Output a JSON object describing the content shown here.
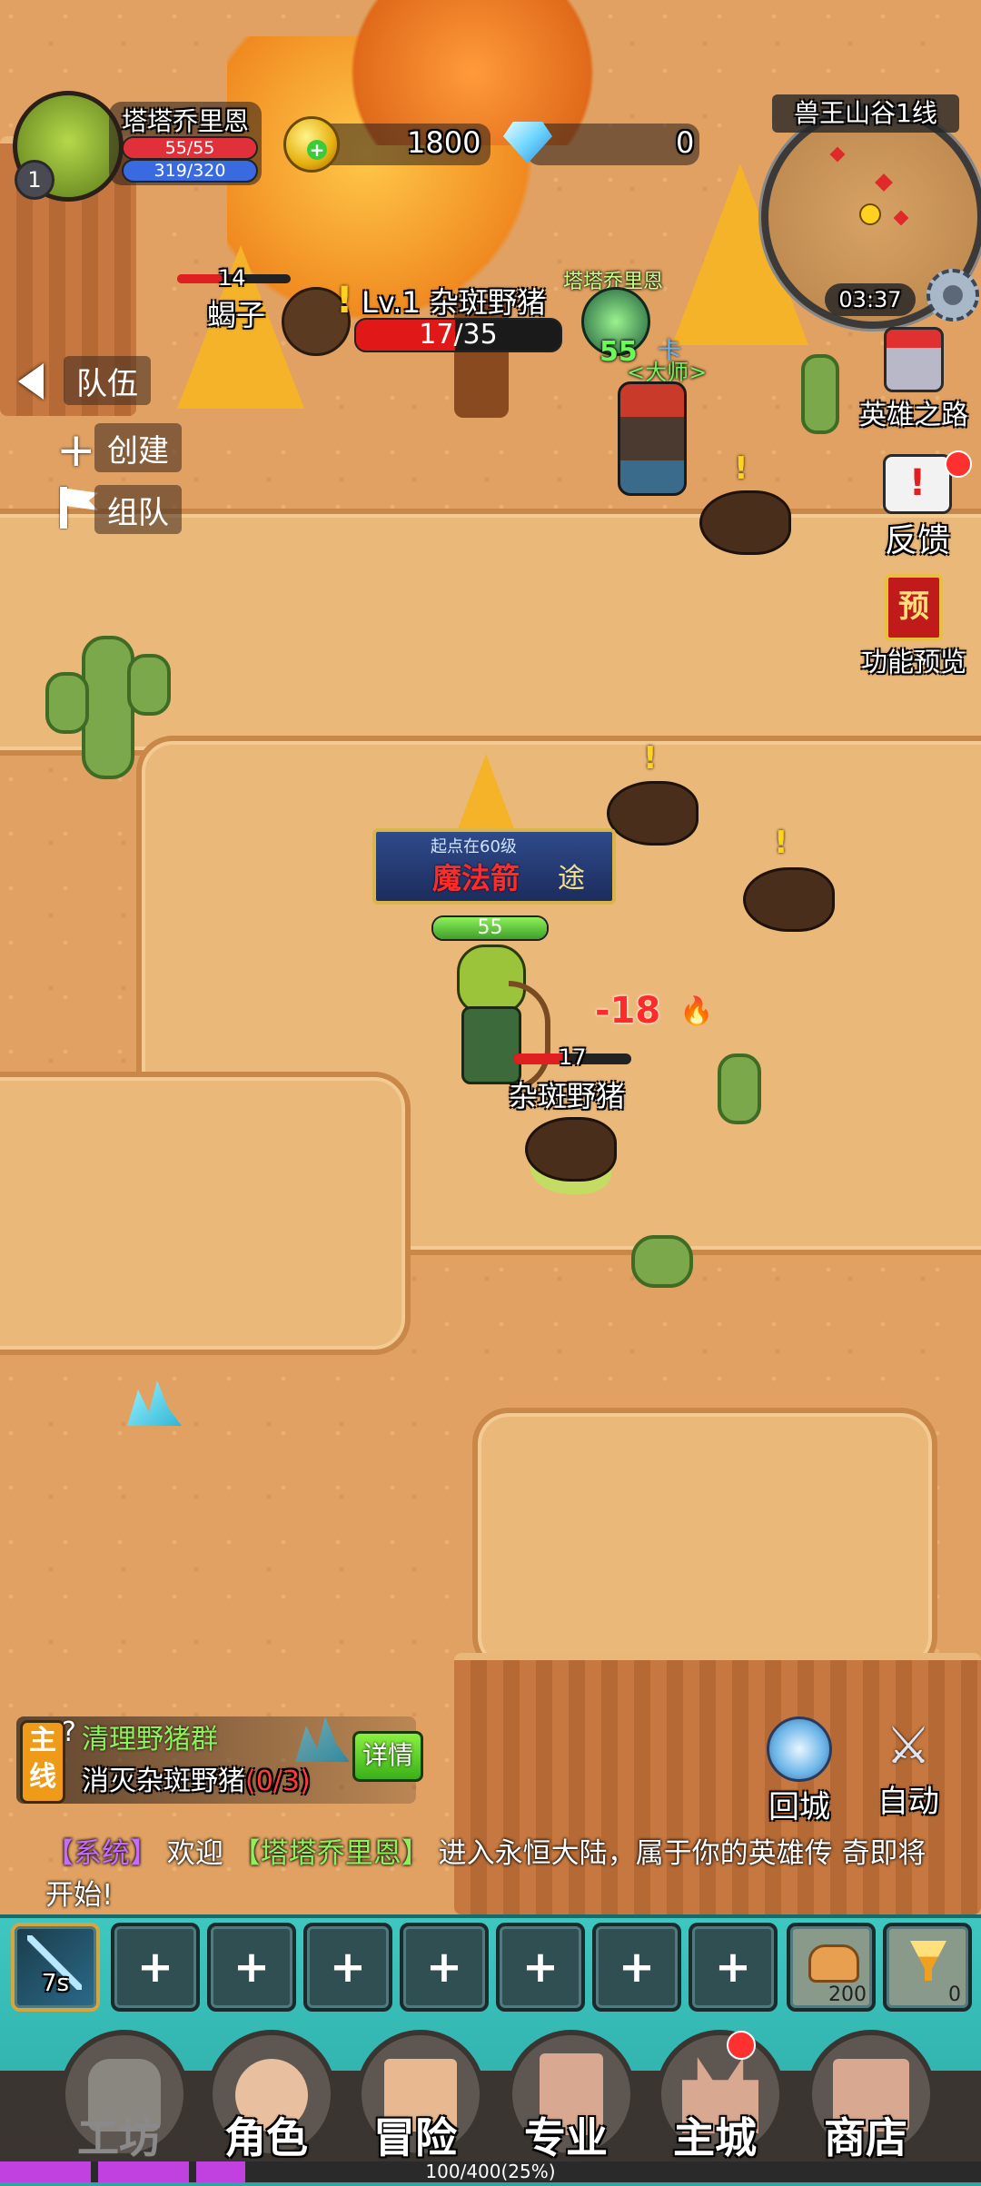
{
  "player": {
    "name": "塔塔乔里恩",
    "level": "1",
    "hp": "55/55",
    "hp_fraction": 1.0,
    "mp": "319/320",
    "mp_fraction": 0.997
  },
  "currency": {
    "gold": "1800",
    "diamonds": "0"
  },
  "minimap": {
    "zone": "兽王山谷1线",
    "time": "03:37"
  },
  "side_menu": {
    "hero_road": "英雄之路",
    "feedback": "反馈",
    "preview_badge": "预",
    "preview": "功能预览"
  },
  "team": {
    "toggle": "队伍",
    "create": "创建",
    "join": "组队"
  },
  "target": {
    "level_name": "Lv.1 杂斑野猪",
    "hp": "17/35",
    "hp_fraction": 0.486
  },
  "world": {
    "scorpion_level": "14",
    "scorpion_name": "蝎子",
    "ally_name": "塔塔乔里恩",
    "ally_level": "55",
    "ally_title_top": "卡",
    "ally_title": "<大师>",
    "player_banner": "起点在60级",
    "player_title": "魔法箭",
    "player_title_suffix": "途",
    "player_level": "55",
    "damage": "-18",
    "boar_level": "17",
    "boar_name": "杂斑野猪"
  },
  "quest": {
    "tag_line1": "主",
    "tag_line2": "线",
    "title": "清理野猪群",
    "objective": "消灭杂斑野猪",
    "progress": "(0/3)",
    "detail_button": "详情"
  },
  "actions": {
    "return_city": "回城",
    "auto": "自动"
  },
  "chat": {
    "channel": "【系统】",
    "prefix": "欢迎",
    "highlight": "【塔塔乔里恩】",
    "line1_rest": "进入永恒大陆，属于你的英雄传",
    "line2": "奇即将开始!"
  },
  "skillbar": {
    "cooldown": "7s",
    "empty_slot": "+",
    "food_count": "200",
    "potion_count": "0"
  },
  "nav": {
    "workshop": "工坊",
    "character": "角色",
    "adventure": "冒险",
    "profession": "专业",
    "city": "主城",
    "shop": "商店"
  },
  "xp": {
    "text": "100/400(25%)",
    "fraction": 0.25
  }
}
